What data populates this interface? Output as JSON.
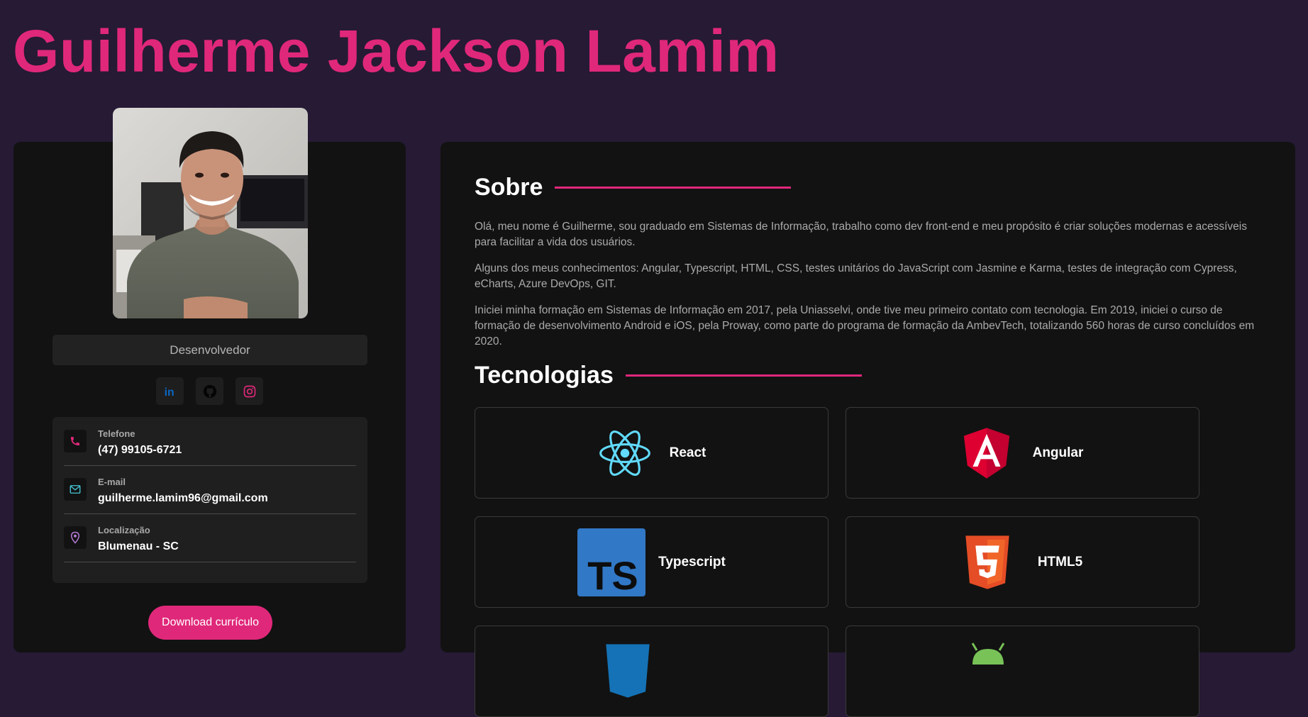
{
  "header": {
    "name": "Guilherme Jackson Lamim"
  },
  "profile": {
    "role": "Desenvolvedor",
    "socials": [
      {
        "name": "LinkedIn",
        "icon": "linkedin-icon",
        "color": "#0a66c2"
      },
      {
        "name": "GitHub",
        "icon": "github-icon",
        "color": "#000000"
      },
      {
        "name": "Instagram",
        "icon": "instagram-icon",
        "color": "#e0287a"
      }
    ],
    "contacts": [
      {
        "label": "Telefone",
        "value": "(47) 99105-6721",
        "icon": "phone-icon"
      },
      {
        "label": "E-mail",
        "value": "guilherme.lamim96@gmail.com",
        "icon": "mail-icon"
      },
      {
        "label": "Localização",
        "value": "Blumenau - SC",
        "icon": "location-icon"
      }
    ],
    "download_label": "Download currículo"
  },
  "about": {
    "title": "Sobre",
    "paragraphs": [
      "Olá, meu nome é Guilherme, sou graduado em Sistemas de Informação, trabalho como dev front-end e meu propósito é criar soluções modernas e acessíveis para facilitar a vida dos usuários.",
      "Alguns dos meus conhecimentos: Angular, Typescript, HTML, CSS, testes unitários do JavaScript com Jasmine e Karma, testes de integração com Cypress, eCharts, Azure DevOps, GIT.",
      "Iniciei minha formação em Sistemas de Informação em 2017, pela Uniasselvi, onde tive meu primeiro contato com tecnologia. Em 2019, iniciei o curso de formação de desenvolvimento Android e iOS, pela Proway, como parte do programa de formação da AmbevTech, totalizando 560 horas de curso concluídos em 2020."
    ]
  },
  "technologies": {
    "title": "Tecnologias",
    "items": [
      {
        "name": "React",
        "icon": "react-icon",
        "color": "#61dafb"
      },
      {
        "name": "Angular",
        "icon": "angular-icon",
        "color": "#b52e31"
      },
      {
        "name": "Typescript",
        "icon": "typescript-icon",
        "color": "#3178c6"
      },
      {
        "name": "HTML5",
        "icon": "html5-icon",
        "color": "#e44d26"
      },
      {
        "name": "",
        "icon": "css3-icon",
        "color": "#1572b6"
      },
      {
        "name": "",
        "icon": "android-icon",
        "color": "#3ddc84"
      }
    ]
  },
  "theme": {
    "background": "#261a35",
    "card": "#121212",
    "accent": "#e0287a"
  }
}
